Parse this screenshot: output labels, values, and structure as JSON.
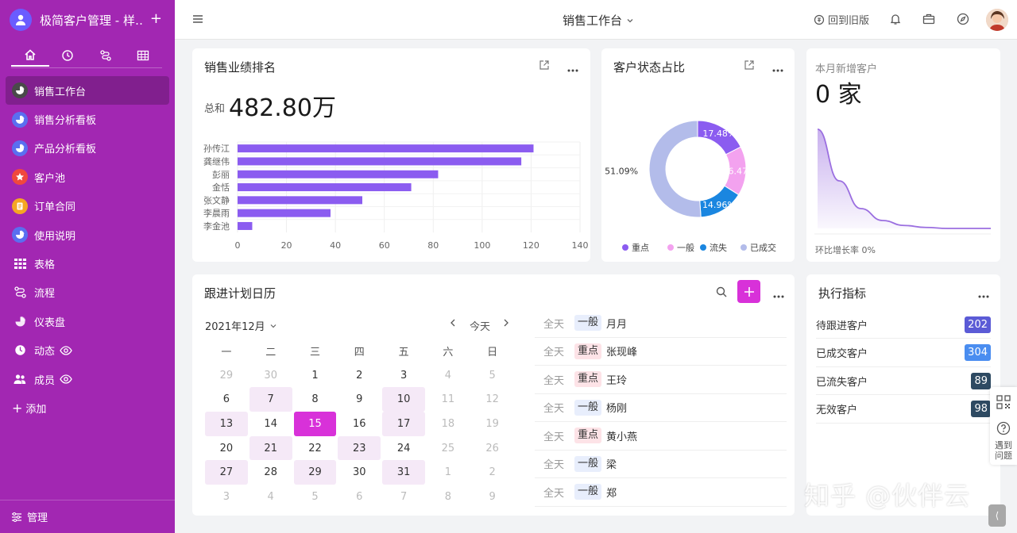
{
  "app": {
    "title": "极简客户管理 - 样…"
  },
  "sidebar": {
    "items": [
      {
        "label": "销售工作台",
        "icon": "pie-chart-icon",
        "color": "#4a4a4a"
      },
      {
        "label": "销售分析看板",
        "icon": "pie-chart-icon",
        "color": "#5a6ff0"
      },
      {
        "label": "产品分析看板",
        "icon": "pie-chart-icon",
        "color": "#5a6ff0"
      },
      {
        "label": "客户池",
        "icon": "star-icon",
        "color": "#f0483e"
      },
      {
        "label": "订单合同",
        "icon": "document-icon",
        "color": "#f5a623"
      },
      {
        "label": "使用说明",
        "icon": "pie-chart-icon",
        "color": "#5a6ff0"
      },
      {
        "label": "表格",
        "icon": "table-icon",
        "color": ""
      },
      {
        "label": "流程",
        "icon": "flow-icon",
        "color": ""
      },
      {
        "label": "仪表盘",
        "icon": "dashboard-icon",
        "color": ""
      },
      {
        "label": "动态",
        "icon": "activity-icon",
        "color": ""
      },
      {
        "label": "成员",
        "icon": "members-icon",
        "color": ""
      }
    ],
    "add_label": "添加",
    "footer_label": "管理"
  },
  "topbar": {
    "title": "销售工作台",
    "back_label": "回到旧版"
  },
  "ranking": {
    "title": "销售业绩排名",
    "sum_label": "总和",
    "sum_value": "482.80万",
    "chart_data": {
      "type": "bar",
      "orientation": "horizontal",
      "categories": [
        "孙传江",
        "龚继伟",
        "彭丽",
        "金恬",
        "张文静",
        "李晨雨",
        "李金池"
      ],
      "values": [
        121,
        116,
        82,
        71,
        51,
        38,
        6
      ],
      "xlim": [
        0,
        140
      ],
      "xticks": [
        0,
        20,
        40,
        60,
        80,
        100,
        120,
        140
      ],
      "color": "#8b5cf0",
      "grid": true
    }
  },
  "status": {
    "title": "客户状态占比",
    "chart_data": {
      "type": "pie",
      "donut": true,
      "labels": [
        "重点",
        "一般",
        "流失",
        "已成交"
      ],
      "values": [
        17.48,
        16.47,
        14.96,
        51.09
      ],
      "value_labels": [
        "17.48%",
        "16.47%",
        "14.96%",
        "51.09%"
      ],
      "colors": [
        "#8b5cf0",
        "#f3a2ef",
        "#1a86e0",
        "#b3bcea"
      ],
      "legend": "bottom"
    }
  },
  "newcust": {
    "label": "本月新增客户",
    "value": "0 家",
    "footer": "环比增长率 0%",
    "chart_data": {
      "type": "area",
      "x": [
        0,
        1,
        2,
        3,
        4,
        5,
        6,
        7,
        8
      ],
      "values": [
        100,
        48,
        20,
        8,
        3,
        1,
        0,
        0,
        0
      ],
      "color": "#9b6fe0"
    }
  },
  "calendar": {
    "title": "跟进计划日历",
    "month": "2021年12月",
    "today": "今天",
    "weekdays": [
      "一",
      "二",
      "三",
      "四",
      "五",
      "六",
      "日"
    ],
    "days": [
      {
        "d": "29",
        "s": "o"
      },
      {
        "d": "30",
        "s": "o"
      },
      {
        "d": "1",
        "s": ""
      },
      {
        "d": "2",
        "s": ""
      },
      {
        "d": "3",
        "s": ""
      },
      {
        "d": "4",
        "s": "o"
      },
      {
        "d": "5",
        "s": "o"
      },
      {
        "d": "6",
        "s": ""
      },
      {
        "d": "7",
        "s": "e"
      },
      {
        "d": "8",
        "s": ""
      },
      {
        "d": "9",
        "s": ""
      },
      {
        "d": "10",
        "s": "e"
      },
      {
        "d": "11",
        "s": "o"
      },
      {
        "d": "12",
        "s": "o"
      },
      {
        "d": "13",
        "s": "e"
      },
      {
        "d": "14",
        "s": ""
      },
      {
        "d": "15",
        "s": "t"
      },
      {
        "d": "16",
        "s": ""
      },
      {
        "d": "17",
        "s": "e"
      },
      {
        "d": "18",
        "s": "o"
      },
      {
        "d": "19",
        "s": "o"
      },
      {
        "d": "20",
        "s": ""
      },
      {
        "d": "21",
        "s": "e"
      },
      {
        "d": "22",
        "s": ""
      },
      {
        "d": "23",
        "s": "e"
      },
      {
        "d": "24",
        "s": ""
      },
      {
        "d": "25",
        "s": "o"
      },
      {
        "d": "26",
        "s": "o"
      },
      {
        "d": "27",
        "s": "e"
      },
      {
        "d": "28",
        "s": ""
      },
      {
        "d": "29",
        "s": "e"
      },
      {
        "d": "30",
        "s": ""
      },
      {
        "d": "31",
        "s": "e"
      },
      {
        "d": "1",
        "s": "o"
      },
      {
        "d": "2",
        "s": "o"
      },
      {
        "d": "3",
        "s": "o"
      },
      {
        "d": "4",
        "s": "o"
      },
      {
        "d": "5",
        "s": "o"
      },
      {
        "d": "6",
        "s": "o"
      },
      {
        "d": "7",
        "s": "o"
      },
      {
        "d": "8",
        "s": "o"
      },
      {
        "d": "9",
        "s": "o"
      }
    ],
    "events": [
      {
        "time": "全天",
        "tag": "一般",
        "kind": "n",
        "name": "月月"
      },
      {
        "time": "全天",
        "tag": "重点",
        "kind": "k",
        "name": "张现峰"
      },
      {
        "time": "全天",
        "tag": "重点",
        "kind": "k",
        "name": "王玲"
      },
      {
        "time": "全天",
        "tag": "一般",
        "kind": "n",
        "name": "杨刚"
      },
      {
        "time": "全天",
        "tag": "重点",
        "kind": "k",
        "name": "黄小燕"
      },
      {
        "time": "全天",
        "tag": "一般",
        "kind": "n",
        "name": "梁"
      },
      {
        "time": "全天",
        "tag": "一般",
        "kind": "n",
        "name": "郑"
      }
    ]
  },
  "indicators": {
    "title": "执行指标",
    "rows": [
      {
        "label": "待跟进客户",
        "value": "202",
        "color": "#5b5bd6"
      },
      {
        "label": "已成交客户",
        "value": "304",
        "color": "#4a8df0"
      },
      {
        "label": "已流失客户",
        "value": "89",
        "color": "#2e4a62"
      },
      {
        "label": "无效客户",
        "value": "98",
        "color": "#2e4a62"
      }
    ]
  },
  "floating": {
    "help_label": "遇到问题"
  },
  "watermark": "知乎 @伙伴云"
}
